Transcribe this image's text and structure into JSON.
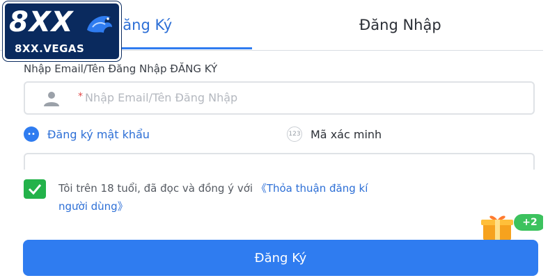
{
  "logo": {
    "main": "8XX",
    "sub": "8XX.VEGAS"
  },
  "tabs": [
    {
      "label": "Đăng Ký",
      "active": true
    },
    {
      "label": "Đăng Nhập",
      "active": false
    }
  ],
  "form": {
    "field_label": "Nhập Email/Tên Đăng Nhập ĐĂNG KÝ",
    "required_mark": "*",
    "username_placeholder": "Nhập Email/Tên Đăng Nhập",
    "options": [
      {
        "label": "Đăng ký mật khẩu",
        "selected": true,
        "icon": "••"
      },
      {
        "label": "Mã xác minh",
        "selected": false,
        "icon": "123"
      }
    ]
  },
  "agreement": {
    "text": "Tôi trên 18 tuổi, đã đọc và đồng ý với ",
    "link_part1": "《Thỏa thuận đăng kí",
    "link_part2": "người dùng》",
    "checked": true
  },
  "gift": {
    "badge": "+2"
  },
  "submit_label": "Đăng Ký",
  "colors": {
    "accent": "#2f7cf0",
    "check": "#23b24a",
    "logo_bg": "#0a2a5e"
  }
}
